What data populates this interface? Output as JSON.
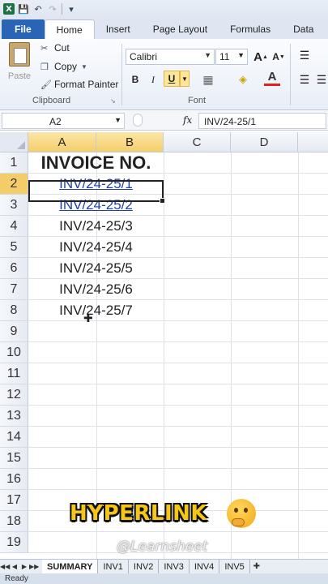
{
  "quick_access": {
    "icons": [
      "excel-logo",
      "save",
      "undo",
      "redo",
      "customize"
    ]
  },
  "tabs": [
    "File",
    "Home",
    "Insert",
    "Page Layout",
    "Formulas",
    "Data"
  ],
  "ribbon": {
    "clipboard": {
      "paste": "Paste",
      "cut": "Cut",
      "copy": "Copy",
      "format_painter": "Format Painter",
      "group_label": "Clipboard"
    },
    "font": {
      "name": "Calibri",
      "size": "11",
      "group_label": "Font",
      "bold": "B",
      "italic": "I",
      "underline": "U"
    }
  },
  "formula_bar": {
    "name_box": "A2",
    "fx": "fx",
    "formula": "INV/24-25/1"
  },
  "grid": {
    "columns": [
      "A",
      "B",
      "C",
      "D"
    ],
    "rows": [
      "1",
      "2",
      "3",
      "4",
      "5",
      "6",
      "7",
      "8",
      "9",
      "10",
      "11",
      "12",
      "13",
      "14",
      "15",
      "16",
      "17",
      "18",
      "19"
    ],
    "cells": [
      {
        "row": 1,
        "text": "INVOICE NO."
      },
      {
        "row": 2,
        "text": "INV/24-25/1"
      },
      {
        "row": 3,
        "text": "INV/24-25/2"
      },
      {
        "row": 4,
        "text": "INV/24-25/3"
      },
      {
        "row": 5,
        "text": "INV/24-25/4"
      },
      {
        "row": 6,
        "text": "INV/24-25/5"
      },
      {
        "row": 7,
        "text": "INV/24-25/6"
      },
      {
        "row": 8,
        "text": "INV/24-25/7"
      }
    ]
  },
  "overlay": {
    "caption": "HYPERLINK",
    "emoji": "thinking-face",
    "watermark": "@Learnsheet"
  },
  "sheets": [
    "SUMMARY",
    "INV1",
    "INV2",
    "INV3",
    "INV4",
    "INV5"
  ],
  "status": "Ready"
}
